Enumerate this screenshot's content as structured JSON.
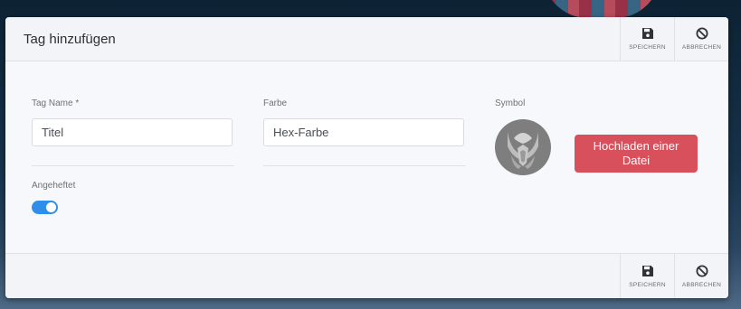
{
  "dialog": {
    "title": "Tag hinzufügen",
    "toolbar": {
      "save_label": "SPEICHERN",
      "cancel_label": "ABBRECHEN"
    },
    "footer": {
      "save_label": "SPEICHERN",
      "cancel_label": "ABBRECHEN"
    },
    "form": {
      "name": {
        "label": "Tag Name *",
        "placeholder": "Titel",
        "value": ""
      },
      "color": {
        "label": "Farbe",
        "placeholder": "Hex-Farbe",
        "value": ""
      },
      "pinned": {
        "label": "Angeheftet",
        "checked": true
      },
      "symbol": {
        "label": "Symbol",
        "upload_label": "Hochladen einer Datei"
      }
    }
  },
  "colors": {
    "accent_blue": "#2f8ee9",
    "upload_red": "#d9505d",
    "avatar_gray": "#7e7e7e"
  },
  "icons": {
    "save": "floppy-disk-icon",
    "cancel": "ban-icon",
    "symbol": "winged-helmet-emblem-icon"
  }
}
